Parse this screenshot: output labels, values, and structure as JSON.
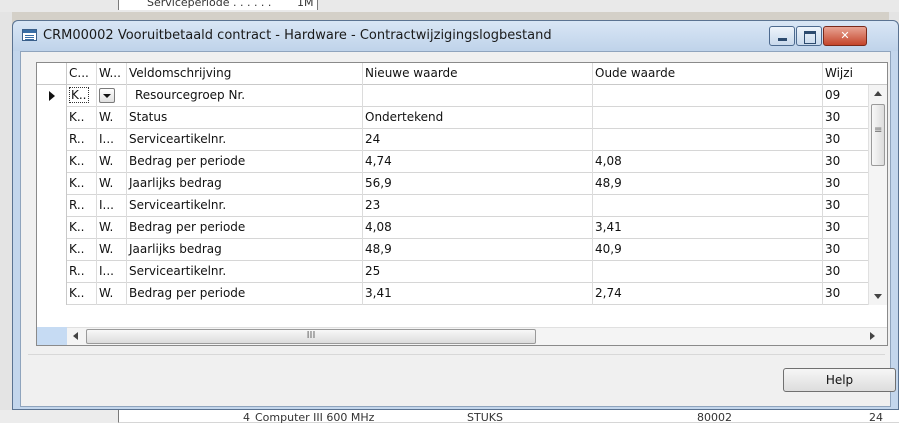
{
  "background": {
    "top_label": "Serviceperiode  . . . . . .",
    "top_value": "1M",
    "bottom_cells": [
      "4",
      "Computer III 600 MHz",
      "STUKS",
      "80002",
      "24"
    ]
  },
  "window": {
    "title": "CRM00002 Vooruitbetaald contract - Hardware - Contractwijzigingslogbestand",
    "minimize_label": "",
    "maximize_label": "",
    "close_label": "✕"
  },
  "grid": {
    "columns": [
      "C...",
      "W...",
      "Veldomschrijving",
      "Nieuwe waarde",
      "Oude waarde",
      "Wijzi"
    ],
    "rows": [
      {
        "c": "K..",
        "w": "",
        "field": "Resourcegroep Nr.",
        "new": "",
        "old": "",
        "date": "09"
      },
      {
        "c": "K..",
        "w": "W.",
        "field": "Status",
        "new": "Ondertekend",
        "old": "",
        "date": "30"
      },
      {
        "c": "R..",
        "w": "I...",
        "field": "Serviceartikelnr.",
        "new": "24",
        "old": "",
        "date": "30"
      },
      {
        "c": "K..",
        "w": "W.",
        "field": "Bedrag per periode",
        "new": "4,74",
        "old": "4,08",
        "date": "30"
      },
      {
        "c": "K..",
        "w": "W.",
        "field": "Jaarlijks bedrag",
        "new": "56,9",
        "old": "48,9",
        "date": "30"
      },
      {
        "c": "R..",
        "w": "I...",
        "field": "Serviceartikelnr.",
        "new": "23",
        "old": "",
        "date": "30"
      },
      {
        "c": "K..",
        "w": "W.",
        "field": "Bedrag per periode",
        "new": "4,08",
        "old": "3,41",
        "date": "30"
      },
      {
        "c": "K..",
        "w": "W.",
        "field": "Jaarlijks bedrag",
        "new": "48,9",
        "old": "40,9",
        "date": "30"
      },
      {
        "c": "R..",
        "w": "I...",
        "field": "Serviceartikelnr.",
        "new": "25",
        "old": "",
        "date": "30"
      },
      {
        "c": "K..",
        "w": "W.",
        "field": "Bedrag per periode",
        "new": "3,41",
        "old": "2,74",
        "date": "30"
      }
    ],
    "hscroll_grip": "III"
  },
  "buttons": {
    "help": "Help"
  }
}
